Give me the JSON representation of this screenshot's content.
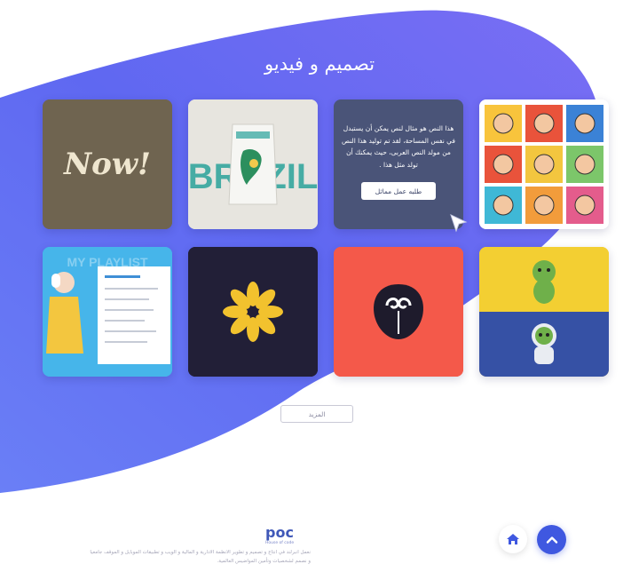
{
  "section": {
    "title": "تصميم و فيديو"
  },
  "portfolio": {
    "hover_caption": "هذا النص هو مثال لنص يمكن أن يستبدل في نفس المساحة، لقد تم توليد هذا النص من مولد النص العربى، حيث يمكنك أن تولد مثل هذا .",
    "hover_button": "طلبه عمل مماثل",
    "card1_art": "Now!",
    "card2_art": "BRAZIL",
    "card5_art": "MY PLAYLIST"
  },
  "more_button": "المزيد",
  "footer": {
    "logo_text": "poc",
    "logo_tagline": "House of code",
    "description": "نعمل انبرلند في انتاج و تصميم و تطوير الانظمة الادارية و المالية و الويب و تطبيقات الموبايل و الموقف جامعيا و نصمم لشخصيات وتأمين المواضيس العالمية."
  },
  "colors": {
    "accent": "#3f58e0",
    "wave_start": "#5b6cf2",
    "wave_end": "#7b72f5"
  },
  "icons": [
    "home-icon",
    "chevron-up-icon",
    "cursor-icon"
  ]
}
